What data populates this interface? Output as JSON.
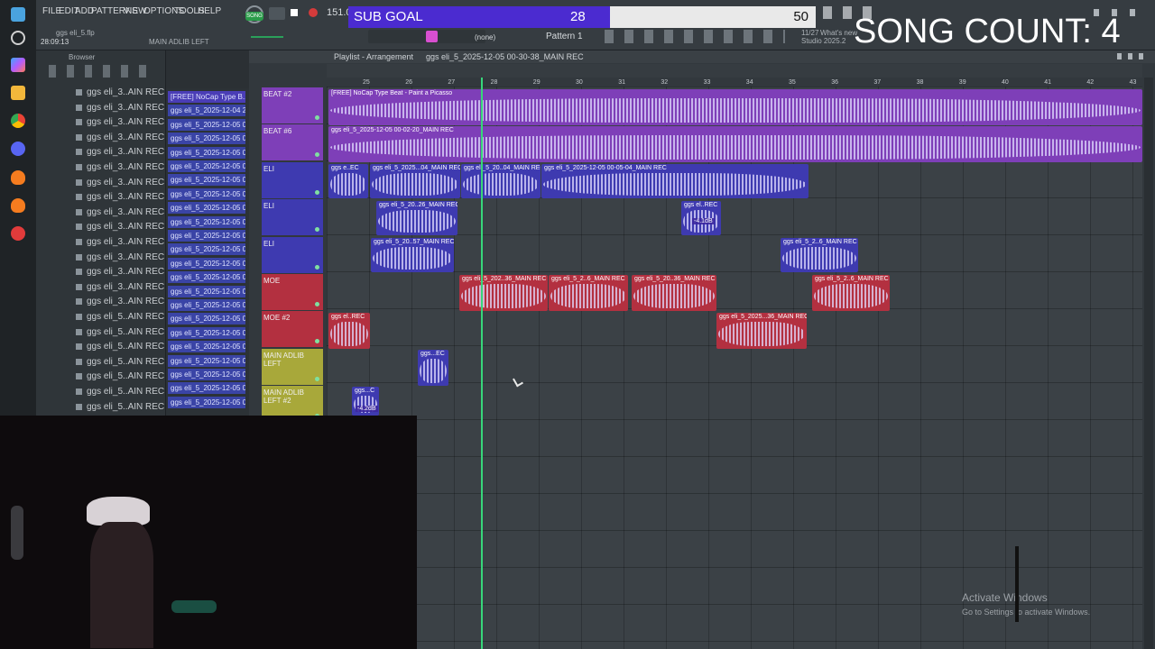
{
  "app": {
    "menu": [
      "FILE",
      "EDIT",
      "ADD",
      "PATTERNS",
      "VIEW",
      "OPTIONS",
      "TOOLS",
      "HELP"
    ],
    "file_name": "ggs eli_5.flp",
    "time": "28:09:13",
    "tempo": "151.0",
    "song_mode": "SONG",
    "hint_track": "MAIN ADLIB LEFT",
    "pattern": "Pattern 1",
    "snap": "(none)",
    "news_date": "11/27",
    "news_label": "What's new",
    "studio_version": "Studio 2025.2"
  },
  "goal": {
    "label": "SUB GOAL",
    "current": "28",
    "target": "50",
    "progress": 0.56
  },
  "song_count": "SONG COUNT: 4",
  "browser": {
    "title": "Browser",
    "items": [
      "ggs eli_3..AIN REC",
      "ggs eli_3..AIN REC",
      "ggs eli_3..AIN REC",
      "ggs eli_3..AIN REC",
      "ggs eli_3..AIN REC",
      "ggs eli_3..AIN REC",
      "ggs eli_3..AIN REC",
      "ggs eli_3..AIN REC",
      "ggs eli_3..AIN REC",
      "ggs eli_3..AIN REC",
      "ggs eli_3..AIN REC",
      "ggs eli_3..AIN REC",
      "ggs eli_3..AIN REC",
      "ggs eli_3..AIN REC",
      "ggs eli_3..AIN REC",
      "ggs eli_5..AIN REC",
      "ggs eli_5..AIN REC",
      "ggs eli_5..AIN REC",
      "ggs eli_5..AIN REC",
      "ggs eli_5..AIN REC",
      "ggs eli_5..AIN REC",
      "ggs eli_5..AIN REC"
    ]
  },
  "clip_list": [
    "[FREE] NoCap Type B...",
    "ggs eli_5_2025-12-04 23...",
    "ggs eli_5_2025-12-05 00...",
    "ggs eli_5_2025-12-05 00...",
    "ggs eli_5_2025-12-05 00...",
    "ggs eli_5_2025-12-05 00...",
    "ggs eli_5_2025-12-05 00...",
    "ggs eli_5_2025-12-05 00...",
    "ggs eli_5_2025-12-05 00...",
    "ggs eli_5_2025-12-05 00...",
    "ggs eli_5_2025-12-05 00...",
    "ggs eli_5_2025-12-05 00...",
    "ggs eli_5_2025-12-05 00...",
    "ggs eli_5_2025-12-05 00...",
    "ggs eli_5_2025-12-05 00...",
    "ggs eli_5_2025-12-05 00...",
    "ggs eli_5_2025-12-05 00...",
    "ggs eli_5_2025-12-05 00...",
    "ggs eli_5_2025-12-05 00...",
    "ggs eli_5_2025-12-05 00...",
    "ggs eli_5_2025-12-05 00...",
    "ggs eli_5_2025-12-05 00...",
    "ggs eli_5_2025-12-05 00..."
  ],
  "playlist": {
    "title": "Playlist - Arrangement",
    "breadcrumb": "ggs eli_5_2025-12-05 00-30-38_MAIN REC",
    "ruler": [
      "25",
      "26",
      "27",
      "28",
      "29",
      "30",
      "31",
      "32",
      "33",
      "34",
      "35",
      "36",
      "37",
      "38",
      "39",
      "40",
      "41",
      "42",
      "43"
    ],
    "tracks": [
      {
        "name": "BEAT #2",
        "color": "#7e3fb8"
      },
      {
        "name": "BEAT #6",
        "color": "#7e3fb8"
      },
      {
        "name": "ELI",
        "color": "#3e3ab0"
      },
      {
        "name": "ELI",
        "color": "#3e3ab0"
      },
      {
        "name": "ELI",
        "color": "#3e3ab0"
      },
      {
        "name": "MOE",
        "color": "#b33040"
      },
      {
        "name": "MOE #2",
        "color": "#b33040"
      },
      {
        "name": "MAIN ADLIB LEFT",
        "color": "#a8a83a"
      },
      {
        "name": "MAIN ADLIB LEFT #2",
        "color": "#a8a83a"
      }
    ],
    "clip_titles": {
      "beat2": "[FREE] NoCap Type Beat - Paint a Picasso",
      "beat6": "ggs eli_5_2025-12-05 00-02-20_MAIN REC",
      "eli_a": "ggs e..EC",
      "eli_b": "ggs eli_5_2025...04_MAIN REC",
      "eli_c": "ggs eli_5_20..04_MAIN REC",
      "eli_d": "ggs eli_5_2025-12-05 00-05-04_MAIN REC",
      "eli2_a": "ggs eli_5_20..26_MAIN REC",
      "eli2_b": "ggs el..REC",
      "eli3_a": "ggs eli_5_20..57_MAIN REC",
      "eli3_b": "ggs eli_5_2..6_MAIN REC",
      "moe_a": "ggs eli_5_202..36_MAIN REC",
      "moe_b": "ggs eli_5_2..6_MAIN REC",
      "moe_c": "ggs eli_5_20..36_MAIN REC",
      "moe_d": "ggs eli_5_2..6_MAIN REC",
      "moe2_a": "ggs el..REC",
      "moe2_b": "ggs eli_5_2025...36_MAIN REC",
      "adlib_a": "ggs...EC",
      "adlib2_a": "ggs...C"
    },
    "gain_labels": [
      "-4.1dB",
      "-4.2dB"
    ]
  },
  "windows": {
    "activate_title": "Activate Windows",
    "activate_sub": "Go to Settings to activate Windows."
  },
  "colors": {
    "goal_fill": "#4b2bd0",
    "playhead": "#37d67a",
    "beat": "#7e3fb8",
    "eli": "#3e3ab0",
    "moe": "#b33040",
    "adlib": "#a8a83a"
  }
}
